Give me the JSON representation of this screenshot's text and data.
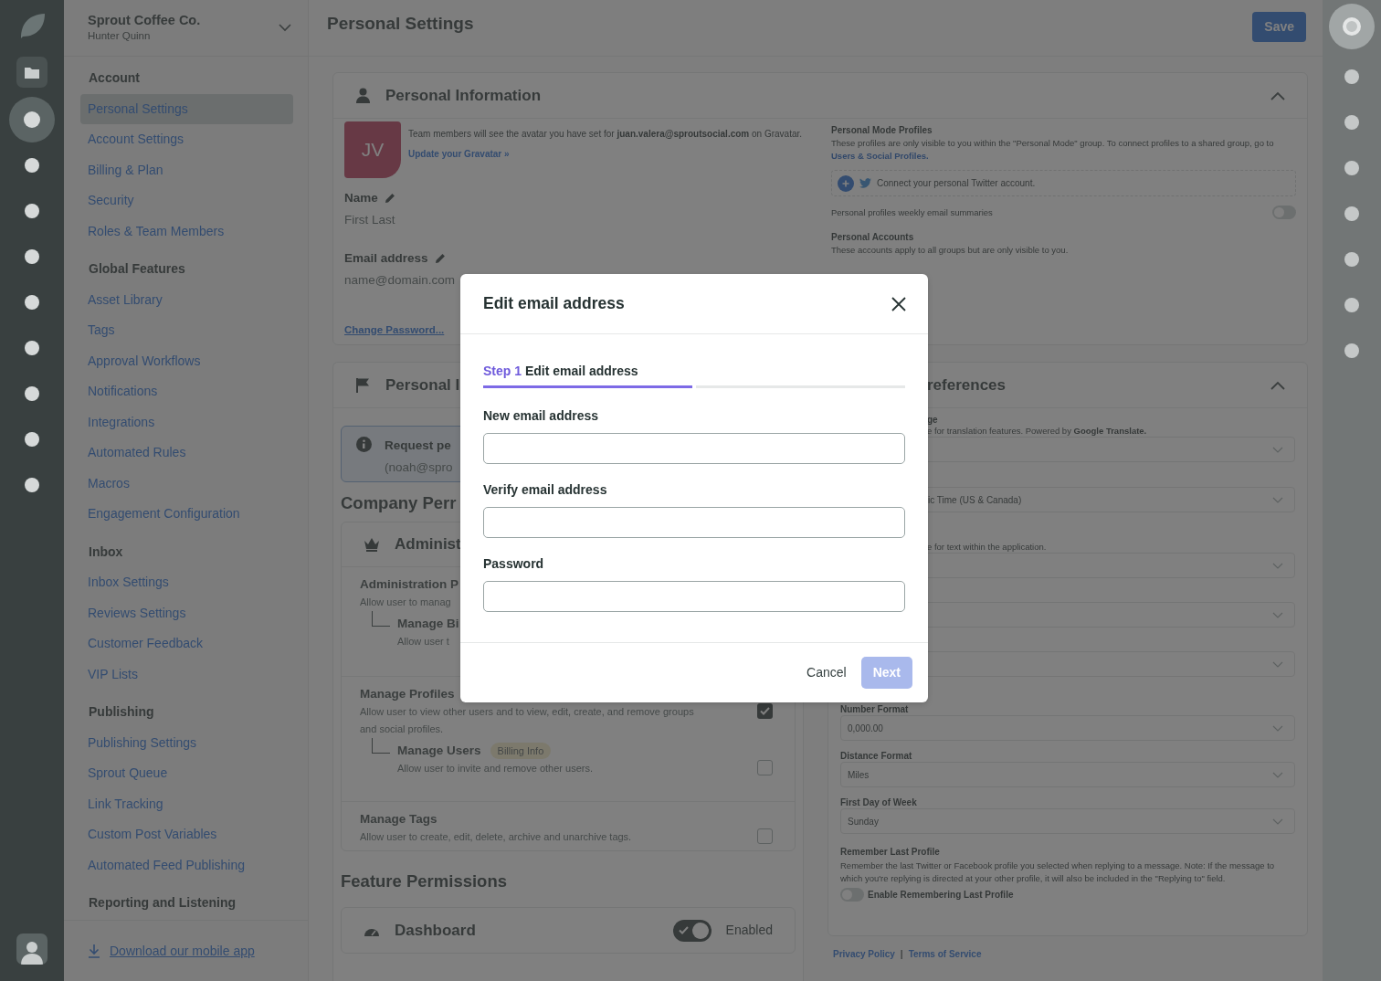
{
  "rail": {
    "items": [
      {
        "kind": "folder",
        "selected": false
      },
      {
        "kind": "dot",
        "selected": true
      },
      {
        "kind": "dot",
        "selected": false
      },
      {
        "kind": "dot",
        "selected": false
      },
      {
        "kind": "dot",
        "selected": false
      },
      {
        "kind": "dot",
        "selected": false
      },
      {
        "kind": "dot",
        "selected": false
      },
      {
        "kind": "dot",
        "selected": false
      },
      {
        "kind": "dot",
        "selected": false
      },
      {
        "kind": "dot",
        "selected": false
      }
    ]
  },
  "sidebar": {
    "org": "Sprout Coffee Co.",
    "user": "Hunter Quinn",
    "sections": [
      {
        "heading": "Account",
        "items": [
          {
            "label": "Personal Settings",
            "selected": true
          },
          {
            "label": "Account Settings",
            "selected": false
          },
          {
            "label": "Billing & Plan",
            "selected": false
          },
          {
            "label": "Security",
            "selected": false
          },
          {
            "label": "Roles & Team Members",
            "selected": false
          }
        ]
      },
      {
        "heading": "Global Features",
        "items": [
          {
            "label": "Asset Library",
            "selected": false
          },
          {
            "label": "Tags",
            "selected": false
          },
          {
            "label": "Approval Workflows",
            "selected": false
          },
          {
            "label": "Notifications",
            "selected": false
          },
          {
            "label": "Integrations",
            "selected": false
          },
          {
            "label": "Automated Rules",
            "selected": false
          },
          {
            "label": "Macros",
            "selected": false
          },
          {
            "label": "Engagement Configuration",
            "selected": false
          }
        ]
      },
      {
        "heading": "Inbox",
        "items": [
          {
            "label": "Inbox Settings",
            "selected": false
          },
          {
            "label": "Reviews Settings",
            "selected": false
          },
          {
            "label": "Customer Feedback",
            "selected": false
          },
          {
            "label": "VIP Lists",
            "selected": false
          }
        ]
      },
      {
        "heading": "Publishing",
        "items": [
          {
            "label": "Publishing Settings",
            "selected": false
          },
          {
            "label": "Sprout Queue",
            "selected": false
          },
          {
            "label": "Link Tracking",
            "selected": false
          },
          {
            "label": "Custom Post Variables",
            "selected": false
          },
          {
            "label": "Automated Feed Publishing",
            "selected": false
          }
        ]
      },
      {
        "heading": "Reporting and Listening"
      }
    ],
    "footer_link": "Download our mobile app"
  },
  "header": {
    "title": "Personal Settings",
    "save_button": "Save"
  },
  "personal_info": {
    "title": "Personal Information",
    "expanded": true,
    "avatar_initials": "JV",
    "avatar_note": "Team members will see the avatar you have set for **juan.valera@sproutsocial.com** on Gravatar.",
    "gravatar_link": "Update your Gravatar »",
    "fields": [
      {
        "label": "Name",
        "value": "First Last"
      },
      {
        "label": "Email address",
        "value": "name@domain.com"
      }
    ],
    "change_password": "Change Password...",
    "mode_profiles": {
      "title": "Personal Mode Profiles",
      "description": "These profiles are only visible to you within the \"Personal Mode\" group. To connect profiles to a shared group, go to",
      "link": "Users & Social Profiles."
    },
    "connect_text": "Connect your personal Twitter account.",
    "weekly_summaries": {
      "label": "Personal profiles weekly email summaries",
      "on": false
    },
    "accounts": {
      "title": "Personal Accounts",
      "description": "These accounts apply to all groups but are only visible to you."
    }
  },
  "personal_card": {
    "title": "Personal I",
    "alert": {
      "title": "Request pe",
      "subtitle": "(noah@spro"
    },
    "company_heading": "Company Perr",
    "admin": {
      "title": "Administ",
      "rows": [
        {
          "title": "Administration P",
          "description": "Allow user to manag",
          "children": [
            {
              "title": "Manage Bi",
              "description": "Allow user t"
            }
          ]
        },
        {
          "title": "Manage Profiles",
          "description": "Allow user to view other users and to view, edit, create, and remove groups and social profiles.",
          "checked": true,
          "children": [
            {
              "title": "Manage Users",
              "tag": "Billing Info",
              "description": "Allow user to invite and remove other users.",
              "checked": false
            }
          ]
        },
        {
          "title": "Manage Tags",
          "description": "Allow user to create, edit, delete, archive and unarchive tags.",
          "checked": false
        }
      ]
    },
    "feature_heading": "Feature Permissions",
    "features": [
      {
        "title": "Dashboard",
        "on": true,
        "state_label": "Enabled"
      }
    ]
  },
  "preferences": {
    "title": "references",
    "expanded": true,
    "fields": [
      {
        "kind": "select",
        "label": "ge",
        "description": "e for translation features. Powered by",
        "link": "Google Translate."
      },
      {
        "kind": "select",
        "value": "ic Time (US & Canada)"
      },
      {
        "kind": "select",
        "description": "e for text within the application."
      },
      {
        "kind": "select"
      },
      {
        "kind": "select"
      },
      {
        "kind": "select",
        "label": "Number Format",
        "value": "0,000.00"
      },
      {
        "kind": "select",
        "label": "Distance Format",
        "value": "Miles"
      },
      {
        "kind": "select",
        "label": "First Day of Week",
        "value": "Sunday"
      }
    ],
    "remember": {
      "title": "Remember Last Profile",
      "description": "Remember the last Twitter or Facebook profile you selected when replying to a message. Note: If the message to which you're replying is directed at your other profile, it will also be included in the \"Replying to\" field.",
      "toggle_label": "Enable Remembering Last Profile",
      "on": false
    }
  },
  "footer_links": {
    "items": [
      "Privacy Policy",
      "Terms of Service"
    ],
    "separator": "|"
  },
  "right_rail": {
    "items": [
      {
        "kind": "avatar",
        "selected": true
      },
      {
        "kind": "dot",
        "selected": false
      },
      {
        "kind": "dot",
        "selected": false
      },
      {
        "kind": "dot",
        "selected": false
      },
      {
        "kind": "dot",
        "selected": false
      },
      {
        "kind": "dot",
        "selected": false
      },
      {
        "kind": "dot",
        "selected": false
      },
      {
        "kind": "dot",
        "selected": false
      }
    ]
  },
  "modal": {
    "title": "Edit email address",
    "steps": [
      {
        "number": "Step 1",
        "title": "Edit email address",
        "active": true
      },
      {
        "active": false
      }
    ],
    "fields": [
      {
        "label": "New email address"
      },
      {
        "label": "Verify email address"
      },
      {
        "label": "Password"
      }
    ],
    "cancel": "Cancel",
    "next": {
      "label": "Next",
      "disabled": true
    }
  }
}
